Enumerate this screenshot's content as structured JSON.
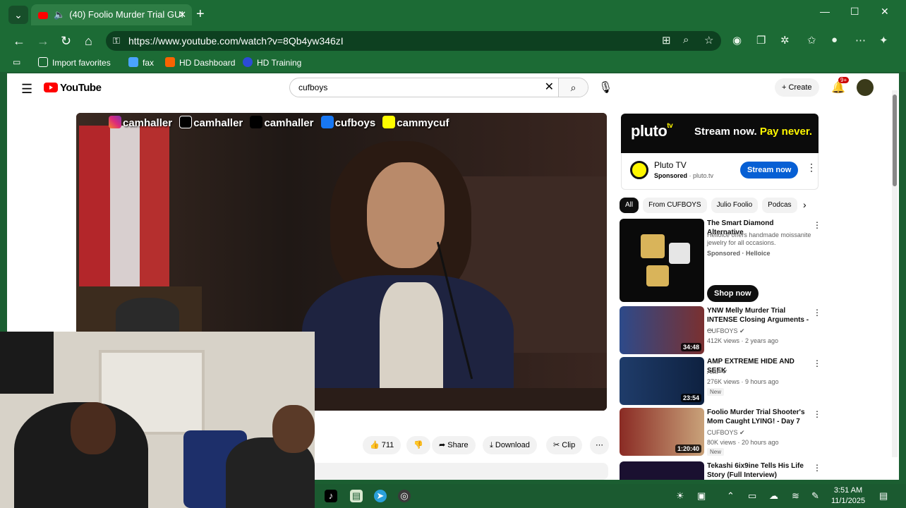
{
  "browser": {
    "tab_title": "(40) Foolio Murder Trial GUI",
    "url": "https://www.youtube.com/watch?v=8Qb4yw346zI",
    "bookmarks": [
      "Import favorites",
      "fax",
      "HD Dashboard",
      "HD Training"
    ]
  },
  "youtube": {
    "logo_text": "YouTube",
    "search_value": "cufboys",
    "create_label": "Create",
    "notification_count": "9+"
  },
  "video": {
    "overlay_socials": [
      "camhaller",
      "camhaller",
      "camhaller",
      "cufboys",
      "cammycuf"
    ],
    "likes": "711",
    "share_label": "Share",
    "download_label": "Download",
    "clip_label": "Clip"
  },
  "ad": {
    "banner_logo": "pluto",
    "banner_logo_sup": "tv",
    "banner_tagline_a": "Stream now.",
    "banner_tagline_b": "Pay never.",
    "name": "Pluto TV",
    "sponsored": "Sponsored",
    "domain": "pluto.tv",
    "cta": "Stream now"
  },
  "chips": [
    "All",
    "From CUFBOYS",
    "Julio Foolio",
    "Podcas"
  ],
  "recommendations": [
    {
      "title": "The Smart Diamond Alternative",
      "desc": "Helloice offers handmade moissanite jewelry for all occasions.",
      "meta1": "Sponsored · Helloice",
      "cta": "Shop now",
      "duration": ""
    },
    {
      "title": "YNW Melly Murder Trial INTENSE Closing Arguments - ...",
      "meta1": "CUFBOYS ✔",
      "meta2": "412K views · 2 years ago",
      "duration": "34:48"
    },
    {
      "title": "AMP EXTREME HIDE AND SEEK",
      "meta1": "AMP ✔",
      "meta2": "276K views · 9 hours ago",
      "badge": "New",
      "duration": "23:54"
    },
    {
      "title": "Foolio Murder Trial Shooter's Mom Caught LYING! - Day 7",
      "meta1": "CUFBOYS ✔",
      "meta2": "80K views · 20 hours ago",
      "badge": "New",
      "duration": "1:20:40"
    },
    {
      "title": "Tekashi 6ix9ine Tells His Life Story (Full Interview)",
      "duration": ""
    }
  ],
  "taskbar": {
    "time": "3:51 AM",
    "date": "11/1/2025"
  },
  "colors": {
    "browser_accent": "#1c6b35",
    "youtube_red": "#ff0000",
    "ad_button": "#065fd4"
  }
}
